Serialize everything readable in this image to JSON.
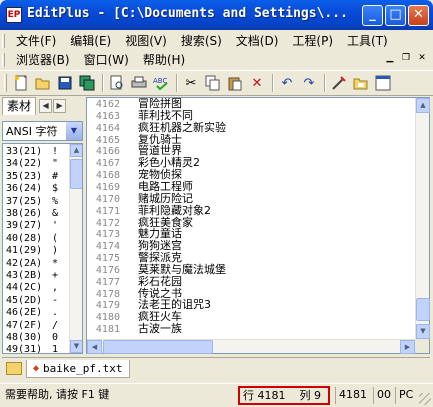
{
  "window": {
    "title": "EditPlus - [C:\\Documents and Settings\\...",
    "app_icon": "EP",
    "controls": [
      "minimize",
      "maximize",
      "close"
    ]
  },
  "menubar": {
    "row1": [
      "文件(F)",
      "编辑(E)",
      "视图(V)",
      "搜索(S)",
      "文档(D)",
      "工程(P)",
      "工具(T)"
    ],
    "row2": [
      "浏览器(B)",
      "窗口(W)",
      "帮助(H)"
    ],
    "mdi_controls": [
      "minimize",
      "restore",
      "close"
    ]
  },
  "toolbar": {
    "icons": [
      "new-file",
      "open-folder",
      "save",
      "save-all",
      "print-preview",
      "print",
      "spell-check",
      "cut",
      "copy",
      "paste",
      "delete",
      "undo",
      "redo",
      "find",
      "directory",
      "pane"
    ]
  },
  "left_panel": {
    "tab_label": "素材",
    "encoding_select": "ANSI 字符",
    "chars": [
      {
        "code": "33(21)",
        "ch": "!"
      },
      {
        "code": "34(22)",
        "ch": "\""
      },
      {
        "code": "35(23)",
        "ch": "#"
      },
      {
        "code": "36(24)",
        "ch": "$"
      },
      {
        "code": "37(25)",
        "ch": "%"
      },
      {
        "code": "38(26)",
        "ch": "&"
      },
      {
        "code": "39(27)",
        "ch": "'"
      },
      {
        "code": "40(28)",
        "ch": "("
      },
      {
        "code": "41(29)",
        "ch": ")"
      },
      {
        "code": "42(2A)",
        "ch": "*"
      },
      {
        "code": "43(2B)",
        "ch": "+"
      },
      {
        "code": "44(2C)",
        "ch": ","
      },
      {
        "code": "45(2D)",
        "ch": "-"
      },
      {
        "code": "46(2E)",
        "ch": "."
      },
      {
        "code": "47(2F)",
        "ch": "/"
      },
      {
        "code": "48(30)",
        "ch": "0"
      },
      {
        "code": "49(31)",
        "ch": "1"
      }
    ]
  },
  "editor": {
    "lines": [
      {
        "n": "4162",
        "t": "冒险拼图"
      },
      {
        "n": "4163",
        "t": "菲利找不同"
      },
      {
        "n": "4164",
        "t": "疯狂机器之新实验"
      },
      {
        "n": "4165",
        "t": "复仇骑士"
      },
      {
        "n": "4166",
        "t": "管道世界"
      },
      {
        "n": "4167",
        "t": "彩色小精灵2"
      },
      {
        "n": "4168",
        "t": "宠物侦探"
      },
      {
        "n": "4169",
        "t": "电路工程师"
      },
      {
        "n": "4170",
        "t": "赌城历险记"
      },
      {
        "n": "4171",
        "t": "菲利隐藏对象2"
      },
      {
        "n": "4172",
        "t": "疯狂美食家"
      },
      {
        "n": "4173",
        "t": "魅力童话"
      },
      {
        "n": "4174",
        "t": "狗狗迷宫"
      },
      {
        "n": "4175",
        "t": "警探派克"
      },
      {
        "n": "4176",
        "t": "莫莱默与魔法城堡"
      },
      {
        "n": "4177",
        "t": "彩石花园"
      },
      {
        "n": "4178",
        "t": "传说之书"
      },
      {
        "n": "4179",
        "t": "法老王的诅咒3"
      },
      {
        "n": "4180",
        "t": "疯狂火车"
      },
      {
        "n": "4181",
        "t": "古波一族"
      }
    ]
  },
  "tabbar": {
    "file_tab": "baike_pf.txt"
  },
  "statusbar": {
    "help": "需要帮助, 请按 F1 键",
    "line": "行 4181",
    "col": "列 9",
    "chars": "4181",
    "c2": "00",
    "mode": "PC"
  }
}
